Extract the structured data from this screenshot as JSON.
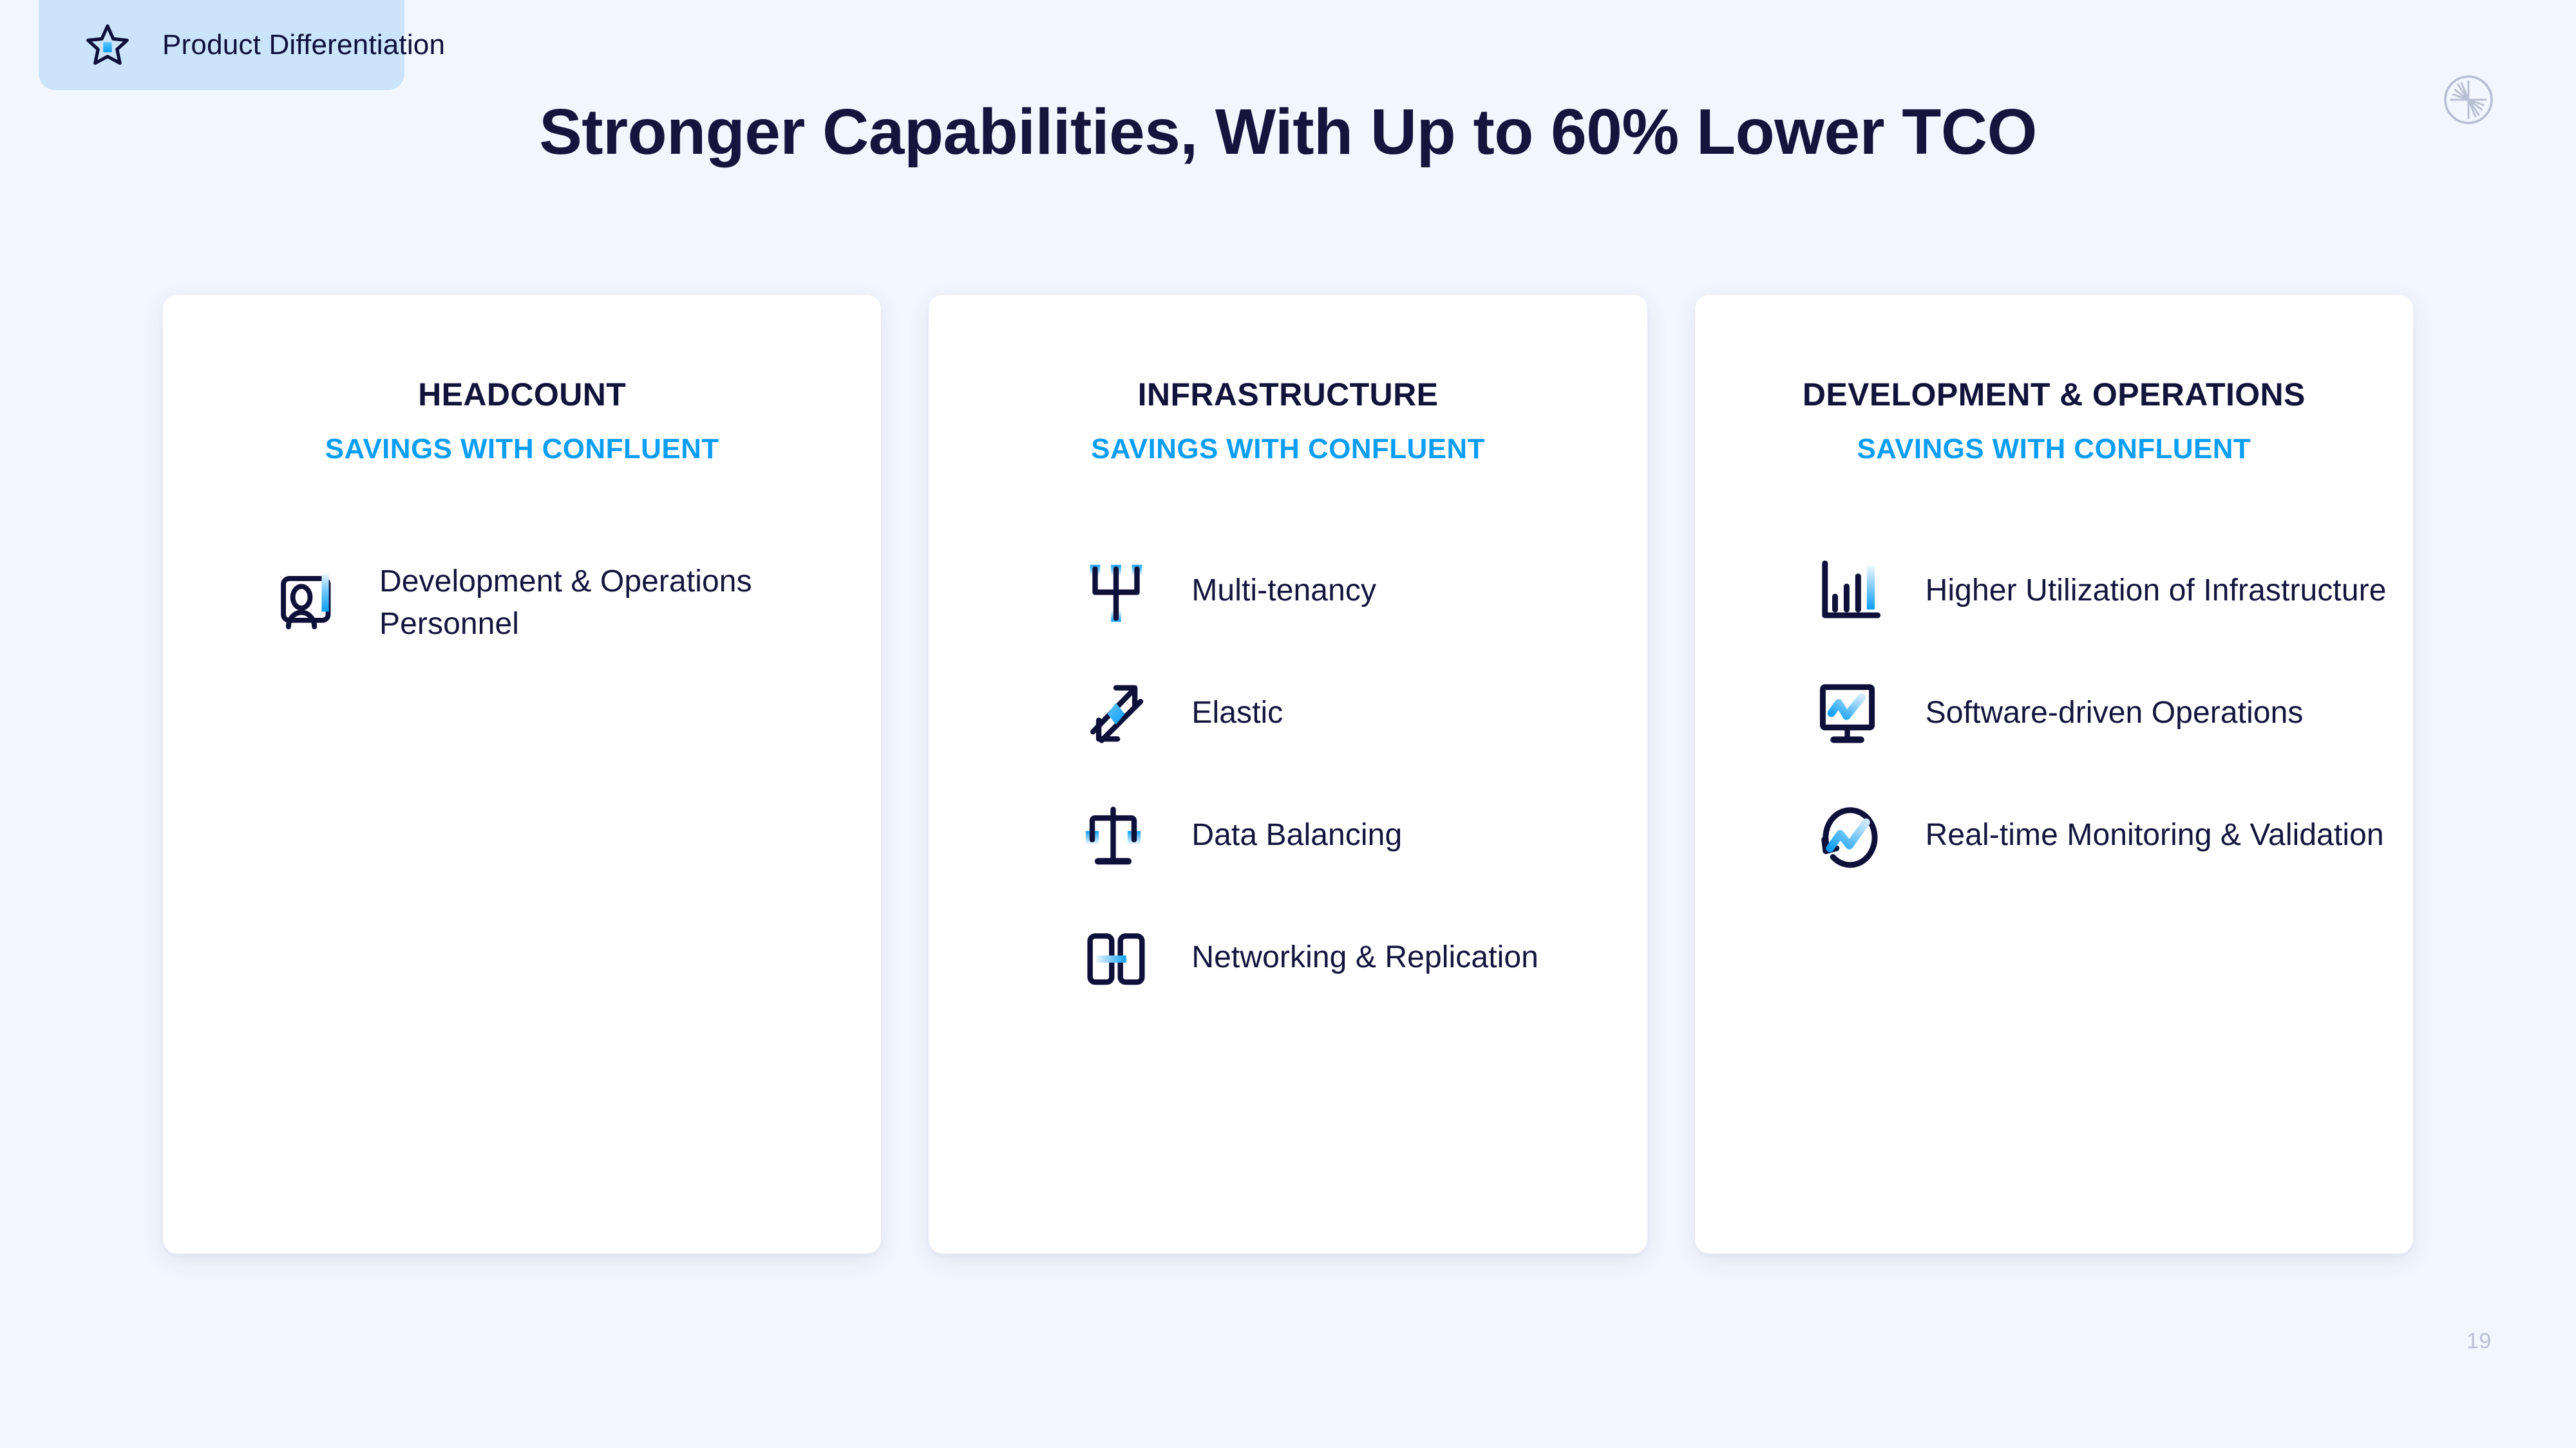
{
  "badge": {
    "label": "Product Differentiation",
    "icon": "star-icon",
    "background_color": "#cbe4fb",
    "text_color": "#0e1039"
  },
  "brandmark": {
    "icon": "confluent-logo-icon",
    "color": "#b8bfd3"
  },
  "title": "Stronger Capabilities, With Up to 60% Lower TCO",
  "title_color": "#15143c",
  "accent_color": "#0c9ef5",
  "background_color": "#f2f6fe",
  "cards": [
    {
      "title": "HEADCOUNT",
      "subtitle": "SAVINGS WITH CONFLUENT",
      "features": [
        {
          "label": "Development & Operations Personnel",
          "icon": "user-profile-card-icon"
        }
      ]
    },
    {
      "title": "INFRASTRUCTURE",
      "subtitle": "SAVINGS WITH CONFLUENT",
      "features": [
        {
          "label": "Multi-tenancy",
          "icon": "trident-multi-tenancy-icon"
        },
        {
          "label": "Elastic",
          "icon": "diagonal-arrows-elastic-icon"
        },
        {
          "label": "Data Balancing",
          "icon": "balance-scale-icon"
        },
        {
          "label": "Networking & Replication",
          "icon": "two-panels-replication-icon"
        }
      ]
    },
    {
      "title": "DEVELOPMENT & OPERATIONS",
      "subtitle": "SAVINGS WITH CONFLUENT",
      "features": [
        {
          "label": "Higher Utilization of Infrastructure",
          "icon": "bar-chart-icon"
        },
        {
          "label": "Software-driven Operations",
          "icon": "monitor-chart-icon"
        },
        {
          "label": "Real-time Monitoring & Validation",
          "icon": "refresh-chart-icon"
        }
      ]
    }
  ],
  "page_number": "19"
}
